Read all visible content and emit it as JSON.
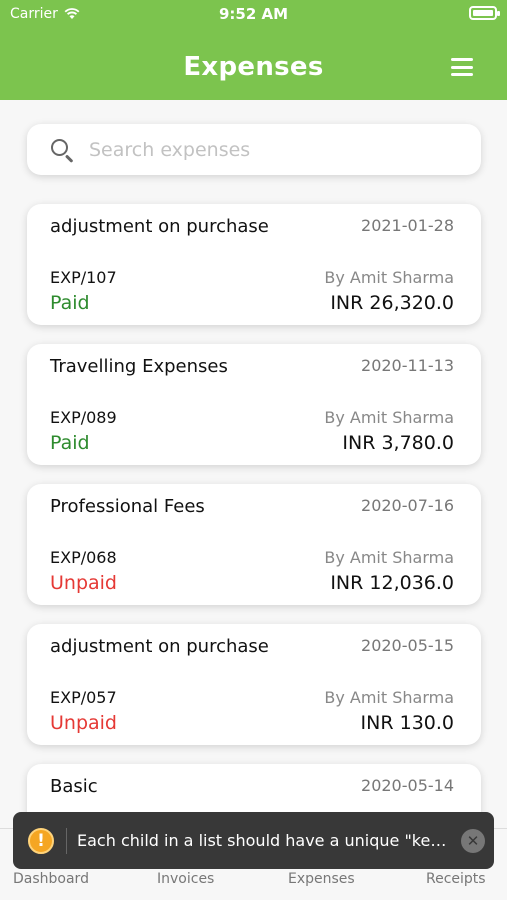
{
  "status_bar": {
    "carrier": "Carrier",
    "time": "9:52 AM"
  },
  "header": {
    "title": "Expenses",
    "menu_icon": "hamburger-menu-icon"
  },
  "search": {
    "placeholder": "Search expenses",
    "value": "",
    "icon": "search-icon"
  },
  "expenses": [
    {
      "name": "adjustment on purchase",
      "date": "2021-01-28",
      "code": "EXP/107",
      "by": "By Amit  Sharma",
      "status": "Paid",
      "amount": "INR 26,320.0"
    },
    {
      "name": "Travelling Expenses",
      "date": "2020-11-13",
      "code": "EXP/089",
      "by": "By Amit  Sharma",
      "status": "Paid",
      "amount": "INR 3,780.0"
    },
    {
      "name": "Professional Fees",
      "date": "2020-07-16",
      "code": "EXP/068",
      "by": "By Amit  Sharma",
      "status": "Unpaid",
      "amount": "INR 12,036.0"
    },
    {
      "name": "adjustment on purchase",
      "date": "2020-05-15",
      "code": "EXP/057",
      "by": "By Amit  Sharma",
      "status": "Unpaid",
      "amount": "INR 130.0"
    },
    {
      "name": "Basic",
      "date": "2020-05-14"
    }
  ],
  "tabs": [
    {
      "label": "Dashboard"
    },
    {
      "label": "Invoices"
    },
    {
      "label": "Expenses"
    },
    {
      "label": "Receipts"
    }
  ],
  "toast": {
    "icon": "warning-icon",
    "message": "Each child in a list should have a unique \"key\"...",
    "close_icon": "close-icon"
  },
  "colors": {
    "header": "#7cc44e",
    "paid": "#2e8b2e",
    "unpaid": "#e53935"
  }
}
